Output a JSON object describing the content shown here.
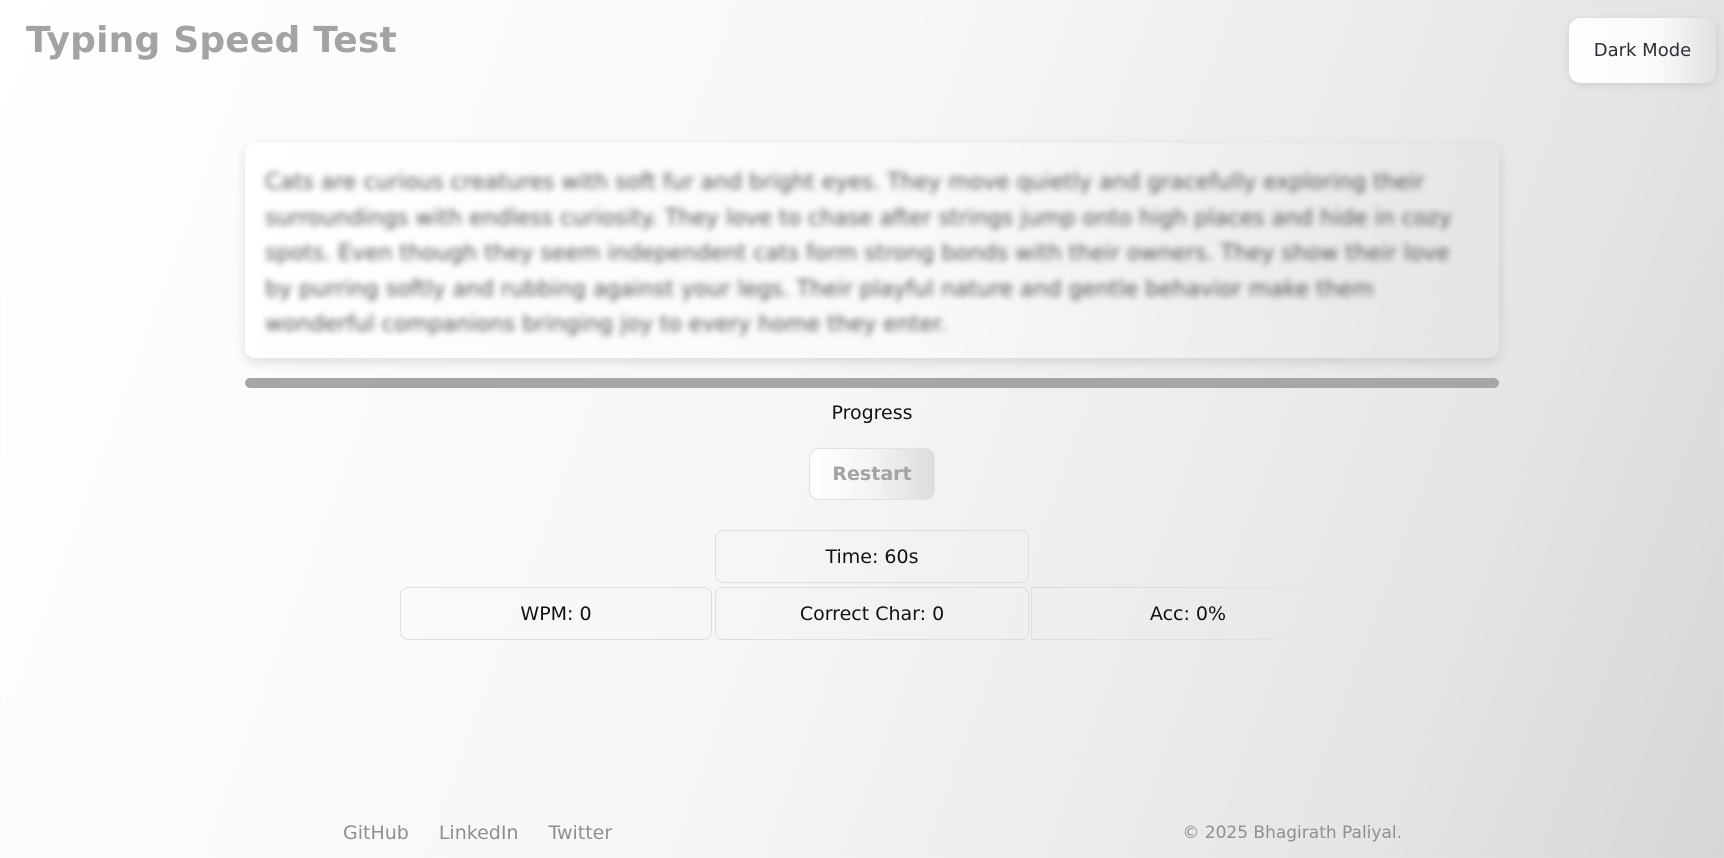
{
  "header": {
    "title": "Typing Speed Test",
    "theme_toggle_label": "Dark Mode"
  },
  "passage": {
    "text": "Cats are curious creatures with soft fur and bright eyes. They move quietly and gracefully exploring their surroundings with endless curiosity. They love to chase after strings jump onto high places and hide in cozy spots. Even though they seem independent cats form strong bonds with their owners. They show their love by purring softly and rubbing against your legs. Their playful nature and gentle behavior make them wonderful companions bringing joy to every home they enter."
  },
  "progress": {
    "label": "Progress",
    "value_percent": 0
  },
  "controls": {
    "restart_label": "Restart"
  },
  "stats": {
    "time": "Time: 60s",
    "wpm": "WPM: 0",
    "correct_chars": "Correct Char: 0",
    "accuracy": "Acc: 0%"
  },
  "footer": {
    "links": [
      "GitHub",
      "LinkedIn",
      "Twitter"
    ],
    "copyright": "© 2025 Bhagirath Paliyal."
  },
  "colors": {
    "title_gray": "#a3a3a3",
    "progress_track": "#a6a6a6",
    "footer_gray": "#8f8f8f"
  }
}
